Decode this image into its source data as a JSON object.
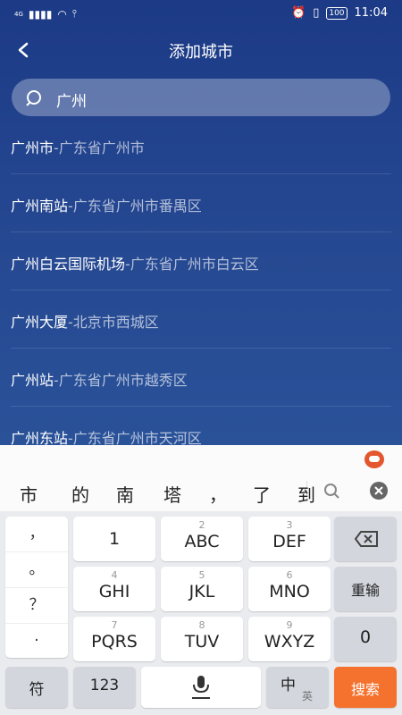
{
  "status": {
    "left": "4G",
    "time": "11:04",
    "battery": "100"
  },
  "header": {
    "title": "添加城市"
  },
  "search": {
    "value": "广州"
  },
  "results": [
    {
      "name": "广州市",
      "addr": "-广东省广州市"
    },
    {
      "name": "广州南站",
      "addr": "-广东省广州市番禺区"
    },
    {
      "name": "广州白云国际机场",
      "addr": "-广东省广州市白云区"
    },
    {
      "name": "广州大厦",
      "addr": "-北京市西城区"
    },
    {
      "name": "广州站",
      "addr": "-广东省广州市越秀区"
    },
    {
      "name": "广州东站",
      "addr": "-广东省广州市天河区"
    }
  ],
  "keyboard": {
    "candidates": [
      "市",
      "的",
      "南",
      "塔",
      "，",
      "了",
      "到"
    ],
    "punct": [
      "，",
      "。",
      "？",
      "·"
    ],
    "keys": [
      {
        "num": "1",
        "label": "1",
        "sub": ""
      },
      {
        "num": "2",
        "label": "ABC"
      },
      {
        "num": "3",
        "label": "DEF"
      },
      {
        "num": "4",
        "label": "GHI"
      },
      {
        "num": "5",
        "label": "JKL"
      },
      {
        "num": "6",
        "label": "MNO"
      },
      {
        "num": "7",
        "label": "PQRS"
      },
      {
        "num": "8",
        "label": "TUV"
      },
      {
        "num": "9",
        "label": "WXYZ"
      }
    ],
    "reenter": "重输",
    "zero": "0",
    "symbol": "符",
    "num123": "123",
    "zh": "中",
    "en": "英",
    "search": "搜索"
  }
}
